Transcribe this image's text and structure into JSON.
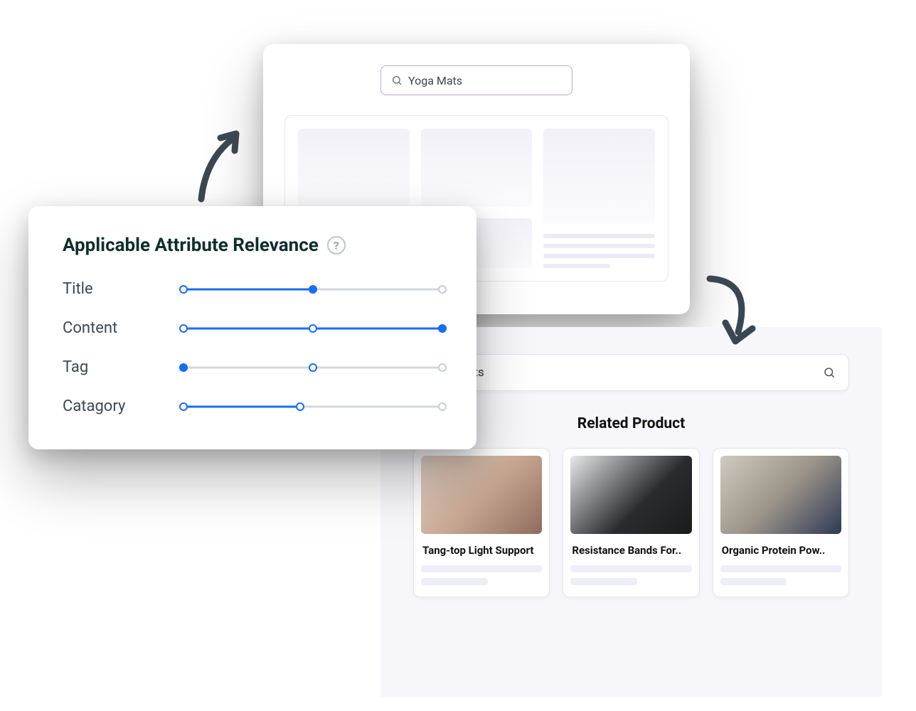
{
  "back_search": {
    "query": "Yoga Mats"
  },
  "attr_panel": {
    "title": "Applicable Attribute Relevance",
    "help_glyph": "?",
    "rows": [
      {
        "label": "Title",
        "fill": 50,
        "handle": 50,
        "handle_filled": true,
        "mid": null,
        "end_grey": true
      },
      {
        "label": "Content",
        "fill": 100,
        "handle": 100,
        "handle_filled": true,
        "mid": 50,
        "end_grey": false
      },
      {
        "label": "Tag",
        "fill": 0,
        "handle": 0,
        "handle_filled": true,
        "mid": 50,
        "end_grey": true
      },
      {
        "label": "Catagory",
        "fill": 45,
        "handle": 45,
        "handle_filled": false,
        "mid": null,
        "end_grey": true
      }
    ]
  },
  "results": {
    "query": "Yoga Mats",
    "section_title": "Related Product",
    "products": [
      {
        "title": "Tang-top Light Support"
      },
      {
        "title": "Resistance Bands For.."
      },
      {
        "title": "Organic Protein Pow.."
      }
    ]
  }
}
